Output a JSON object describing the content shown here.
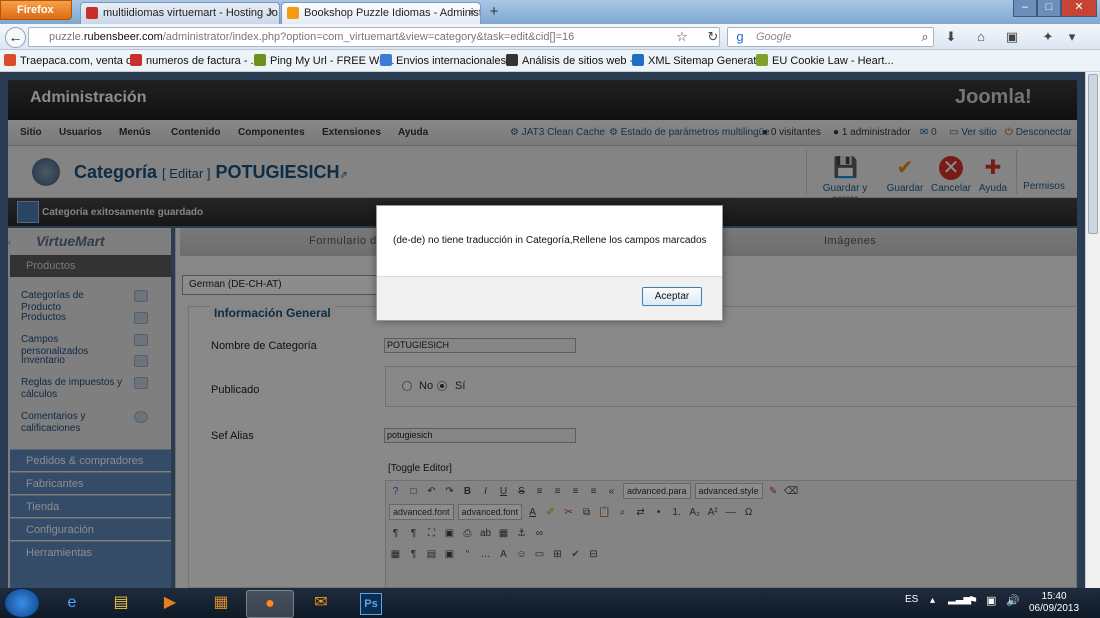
{
  "browser": {
    "app_button": "Firefox",
    "tabs": [
      {
        "title": "multiidiomas virtuemart - Hosting Jo...",
        "close": "×"
      },
      {
        "title": "Bookshop Puzzle Idiomas - Administr...",
        "close": "×"
      }
    ],
    "new_tab": "+",
    "url_domain": "puzzle.rubensbeer.com",
    "url_rest": "/administrator/index.php?option=com_virtuemart&view=category&task=edit&cid[]=16",
    "url_prefix": "puzzle.",
    "url_host": "rubensbeer.com",
    "search_placeholder": "Google",
    "bookmarks": [
      "Traepaca.com, venta d...",
      "numeros de factura - ...",
      "Ping My Url - FREE We...",
      "Envios internacionales ...",
      "Análisis de sitios web -...",
      "XML Sitemap Generat...",
      "EU Cookie Law - Heart..."
    ]
  },
  "joomla": {
    "header_title": "Administración",
    "logo": "Joomla!",
    "menu": [
      "Sitio",
      "Usuarios",
      "Menús",
      "Contenido",
      "Componentes",
      "Extensiones",
      "Ayuda"
    ],
    "status": {
      "cache": "JAT3 Clean Cache",
      "multilang": "Estado de parámetros multilingüe",
      "visitors": "0 visitantes",
      "admins": "1 administrador",
      "messages": "0",
      "view_site": "Ver sitio",
      "logout": "Desconectar"
    },
    "page_title": "Categoría",
    "page_edit": "[ Editar ]",
    "page_name": "POTUGIESICH",
    "toolbar": {
      "save_close": "Guardar y cerrar",
      "save": "Guardar",
      "cancel": "Cancelar",
      "help": "Ayuda",
      "permissions": "Permisos"
    },
    "message": "Categoría exitosamente guardado"
  },
  "sidebar": {
    "logo": "VirtueMart",
    "section": "Productos",
    "items": [
      "Categorías de Producto",
      "Productos",
      "Campos personalizados",
      "Inventario",
      "Reglas de impuestos y cálculos",
      "Comentarios y calificaciones"
    ],
    "sections": [
      "Pedidos & compradores",
      "Fabricantes",
      "Tienda",
      "Configuración",
      "Herramientas"
    ]
  },
  "form": {
    "tabs": [
      "Formulario d",
      "Imágenes"
    ],
    "language": "German (DE-CH-AT)",
    "legend": "Información General",
    "name_label": "Nombre de Categoría",
    "name_value": "POTUGIESICH",
    "published_label": "Publicado",
    "no_label": "No",
    "yes_label": "Sí",
    "alias_label": "Sef Alias",
    "alias_value": "potugiesich",
    "toggle_editor": "[Toggle Editor]",
    "editor_selects": [
      "advanced.para",
      "advanced.style",
      "advanced.font",
      "advanced.font"
    ]
  },
  "dialog": {
    "message": "(de-de) no tiene traducción in Categoría,Rellene los campos marcados",
    "ok_label": "Aceptar"
  },
  "taskbar": {
    "lang": "ES",
    "time": "15:40",
    "date": "06/09/2013"
  },
  "colors": {
    "joomla_blue": "#19507e",
    "link_blue": "#235d8c",
    "sidebar_section": "#5f8bbd"
  }
}
